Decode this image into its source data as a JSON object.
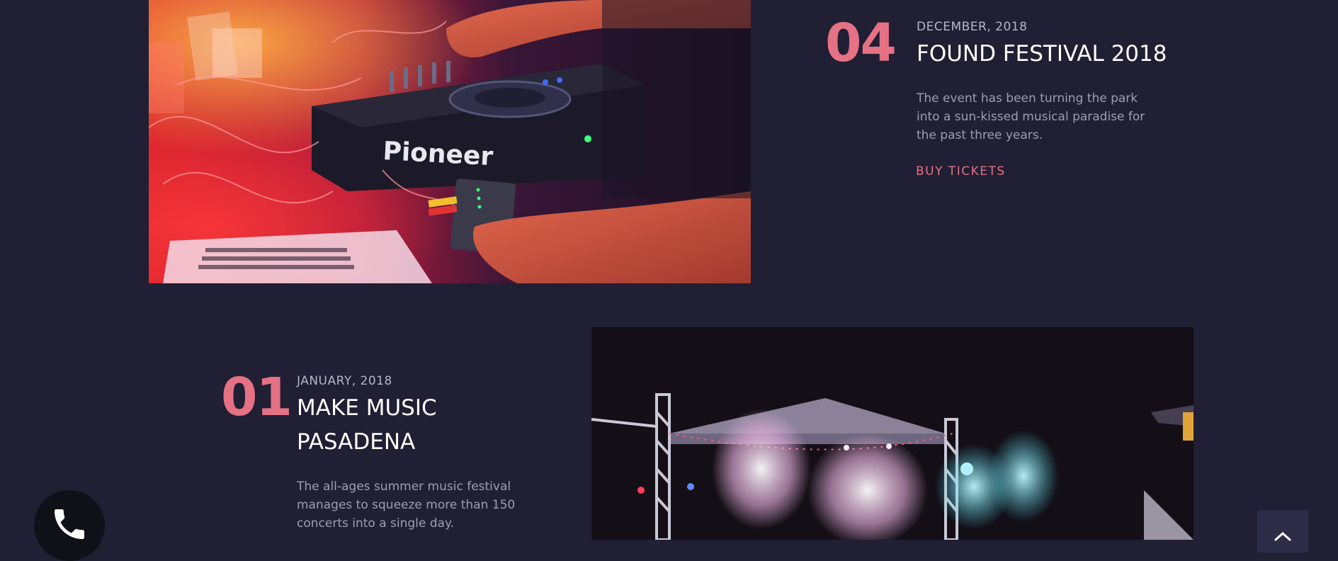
{
  "events": [
    {
      "number": "04",
      "date": "DECEMBER, 2018",
      "title": "FOUND FESTIVAL 2018",
      "description": "The event has been turning the park into a sun-kissed musical paradise for the past three years.",
      "cta_label": "BUY TICKETS"
    },
    {
      "number": "01",
      "date": "JANUARY, 2018",
      "title": "MAKE MUSIC PASADENA",
      "description": "The all-ages summer music festival manages to squeeze more than 150 concerts into a single day."
    }
  ],
  "dj_photo": {
    "brand_text": "Pioneer"
  },
  "widgets": {
    "phone_icon": "phone-icon",
    "scroll_top_icon": "chevron-up-icon"
  },
  "colors": {
    "background": "#201f33",
    "accent": "#e57184",
    "date": "#b7b6c6",
    "text_muted": "#9e9db2"
  }
}
